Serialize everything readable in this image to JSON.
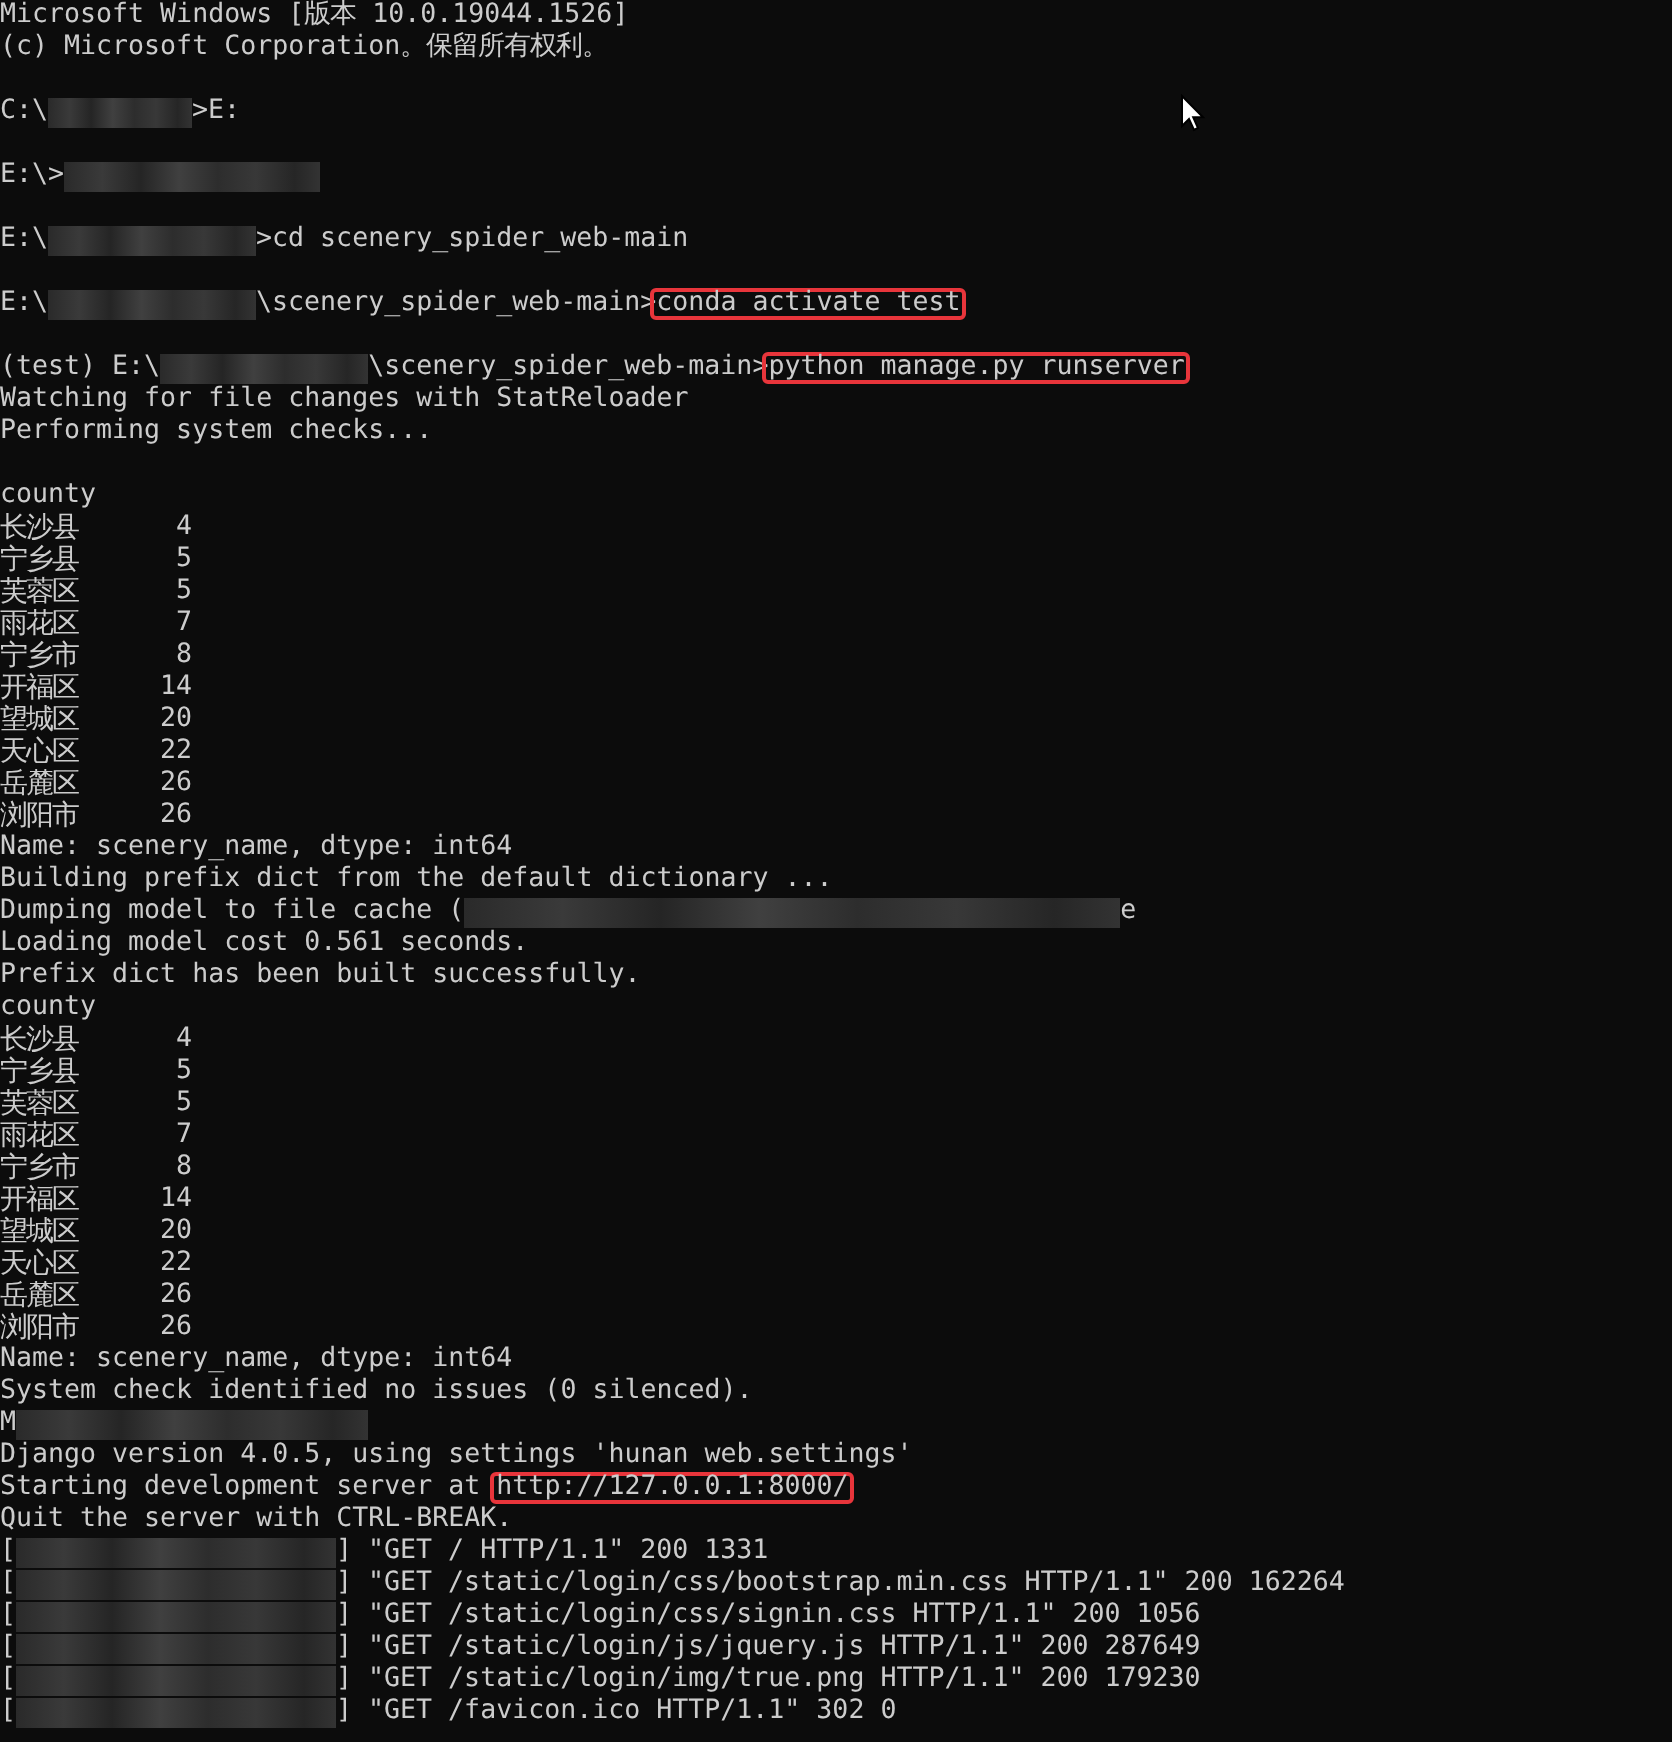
{
  "console": {
    "lines": [
      {
        "kind": "text",
        "segments": [
          {
            "kind": "text",
            "text": "Microsoft Windows [版本 10.0.19044.1526]"
          }
        ]
      },
      {
        "kind": "text",
        "segments": [
          {
            "kind": "text",
            "text": "(c) Microsoft Corporation。保留所有权利。"
          }
        ]
      },
      {
        "kind": "blank"
      },
      {
        "kind": "text",
        "segments": [
          {
            "kind": "text",
            "text": "C:\\"
          },
          {
            "kind": "redacted"
          },
          {
            "kind": "text",
            "text": ">E:"
          }
        ]
      },
      {
        "kind": "blank"
      },
      {
        "kind": "text",
        "segments": [
          {
            "kind": "text",
            "text": "E:\\>"
          },
          {
            "kind": "redacted"
          }
        ]
      },
      {
        "kind": "blank"
      },
      {
        "kind": "text",
        "segments": [
          {
            "kind": "text",
            "text": "E:\\"
          },
          {
            "kind": "redacted"
          },
          {
            "kind": "text",
            "text": ">cd scenery_spider_web-main"
          }
        ]
      },
      {
        "kind": "blank"
      },
      {
        "kind": "text",
        "segments": [
          {
            "kind": "text",
            "text": "E:\\"
          },
          {
            "kind": "redacted"
          },
          {
            "kind": "text",
            "text": "\\scenery_spider_web-main>"
          },
          {
            "kind": "highlight",
            "text": "conda activate test"
          }
        ]
      },
      {
        "kind": "blank"
      },
      {
        "kind": "text",
        "segments": [
          {
            "kind": "text",
            "text": "(test) E:\\"
          },
          {
            "kind": "redacted"
          },
          {
            "kind": "text",
            "text": "\\scenery_spider_web-main>"
          },
          {
            "kind": "highlight",
            "text": "python manage.py runserver"
          }
        ]
      },
      {
        "kind": "text",
        "segments": [
          {
            "kind": "text",
            "text": "Watching for file changes with StatReloader"
          }
        ]
      },
      {
        "kind": "text",
        "segments": [
          {
            "kind": "text",
            "text": "Performing system checks..."
          }
        ]
      },
      {
        "kind": "blank"
      },
      {
        "kind": "text",
        "segments": [
          {
            "kind": "text",
            "text": "county"
          }
        ]
      },
      {
        "kind": "series_row",
        "name": "长沙县",
        "value": "4"
      },
      {
        "kind": "series_row",
        "name": "宁乡县",
        "value": "5"
      },
      {
        "kind": "series_row",
        "name": "芙蓉区",
        "value": "5"
      },
      {
        "kind": "series_row",
        "name": "雨花区",
        "value": "7"
      },
      {
        "kind": "series_row",
        "name": "宁乡市",
        "value": "8"
      },
      {
        "kind": "series_row",
        "name": "开福区",
        "value": "14"
      },
      {
        "kind": "series_row",
        "name": "望城区",
        "value": "20"
      },
      {
        "kind": "series_row",
        "name": "天心区",
        "value": "22"
      },
      {
        "kind": "series_row",
        "name": "岳麓区",
        "value": "26"
      },
      {
        "kind": "series_row",
        "name": "浏阳市",
        "value": "26"
      },
      {
        "kind": "text",
        "segments": [
          {
            "kind": "text",
            "text": "Name: scenery_name, dtype: int64"
          }
        ]
      },
      {
        "kind": "text",
        "segments": [
          {
            "kind": "text",
            "text": "Building prefix dict from the default dictionary ..."
          }
        ]
      },
      {
        "kind": "text",
        "segments": [
          {
            "kind": "text",
            "text": "Dumping model to file cache ("
          },
          {
            "kind": "redacted"
          },
          {
            "kind": "text",
            "text": "e"
          }
        ]
      },
      {
        "kind": "text",
        "segments": [
          {
            "kind": "text",
            "text": "Loading model cost 0.561 seconds."
          }
        ]
      },
      {
        "kind": "text",
        "segments": [
          {
            "kind": "text",
            "text": "Prefix dict has been built successfully."
          }
        ]
      },
      {
        "kind": "text",
        "segments": [
          {
            "kind": "text",
            "text": "county"
          }
        ]
      },
      {
        "kind": "series_row",
        "name": "长沙县",
        "value": "4"
      },
      {
        "kind": "series_row",
        "name": "宁乡县",
        "value": "5"
      },
      {
        "kind": "series_row",
        "name": "芙蓉区",
        "value": "5"
      },
      {
        "kind": "series_row",
        "name": "雨花区",
        "value": "7"
      },
      {
        "kind": "series_row",
        "name": "宁乡市",
        "value": "8"
      },
      {
        "kind": "series_row",
        "name": "开福区",
        "value": "14"
      },
      {
        "kind": "series_row",
        "name": "望城区",
        "value": "20"
      },
      {
        "kind": "series_row",
        "name": "天心区",
        "value": "22"
      },
      {
        "kind": "series_row",
        "name": "岳麓区",
        "value": "26"
      },
      {
        "kind": "series_row",
        "name": "浏阳市",
        "value": "26"
      },
      {
        "kind": "text",
        "segments": [
          {
            "kind": "text",
            "text": "Name: scenery_name, dtype: int64"
          }
        ]
      },
      {
        "kind": "text",
        "segments": [
          {
            "kind": "text",
            "text": "System check identified no issues (0 silenced)."
          }
        ]
      },
      {
        "kind": "text",
        "segments": [
          {
            "kind": "text",
            "text": "M"
          },
          {
            "kind": "redacted"
          }
        ]
      },
      {
        "kind": "text",
        "segments": [
          {
            "kind": "text",
            "text": "Django version 4.0.5, using settings 'hunan web.settings'"
          }
        ]
      },
      {
        "kind": "text",
        "segments": [
          {
            "kind": "text",
            "text": "Starting development server at "
          },
          {
            "kind": "highlight",
            "text": "http://127.0.0.1:8000/"
          }
        ]
      },
      {
        "kind": "text",
        "segments": [
          {
            "kind": "text",
            "text": "Quit the server with CTRL-BREAK."
          }
        ]
      },
      {
        "kind": "text",
        "segments": [
          {
            "kind": "text",
            "text": "["
          },
          {
            "kind": "redacted"
          },
          {
            "kind": "text",
            "text": "] \"GET / HTTP/1.1\" 200 1331"
          }
        ]
      },
      {
        "kind": "text",
        "segments": [
          {
            "kind": "text",
            "text": "["
          },
          {
            "kind": "redacted"
          },
          {
            "kind": "text",
            "text": "] \"GET /static/login/css/bootstrap.min.css HTTP/1.1\" 200 162264"
          }
        ]
      },
      {
        "kind": "text",
        "segments": [
          {
            "kind": "text",
            "text": "["
          },
          {
            "kind": "redacted"
          },
          {
            "kind": "text",
            "text": "] \"GET /static/login/css/signin.css HTTP/1.1\" 200 1056"
          }
        ]
      },
      {
        "kind": "text",
        "segments": [
          {
            "kind": "text",
            "text": "["
          },
          {
            "kind": "redacted"
          },
          {
            "kind": "text",
            "text": "] \"GET /static/login/js/jquery.js HTTP/1.1\" 200 287649"
          }
        ]
      },
      {
        "kind": "text",
        "segments": [
          {
            "kind": "text",
            "text": "["
          },
          {
            "kind": "redacted"
          },
          {
            "kind": "text",
            "text": "] \"GET /static/login/img/true.png HTTP/1.1\" 200 179230"
          }
        ]
      },
      {
        "kind": "text",
        "segments": [
          {
            "kind": "text",
            "text": "["
          },
          {
            "kind": "redacted"
          },
          {
            "kind": "text",
            "text": "] \"GET /favicon.ico HTTP/1.1\" 302 0"
          }
        ]
      }
    ]
  }
}
